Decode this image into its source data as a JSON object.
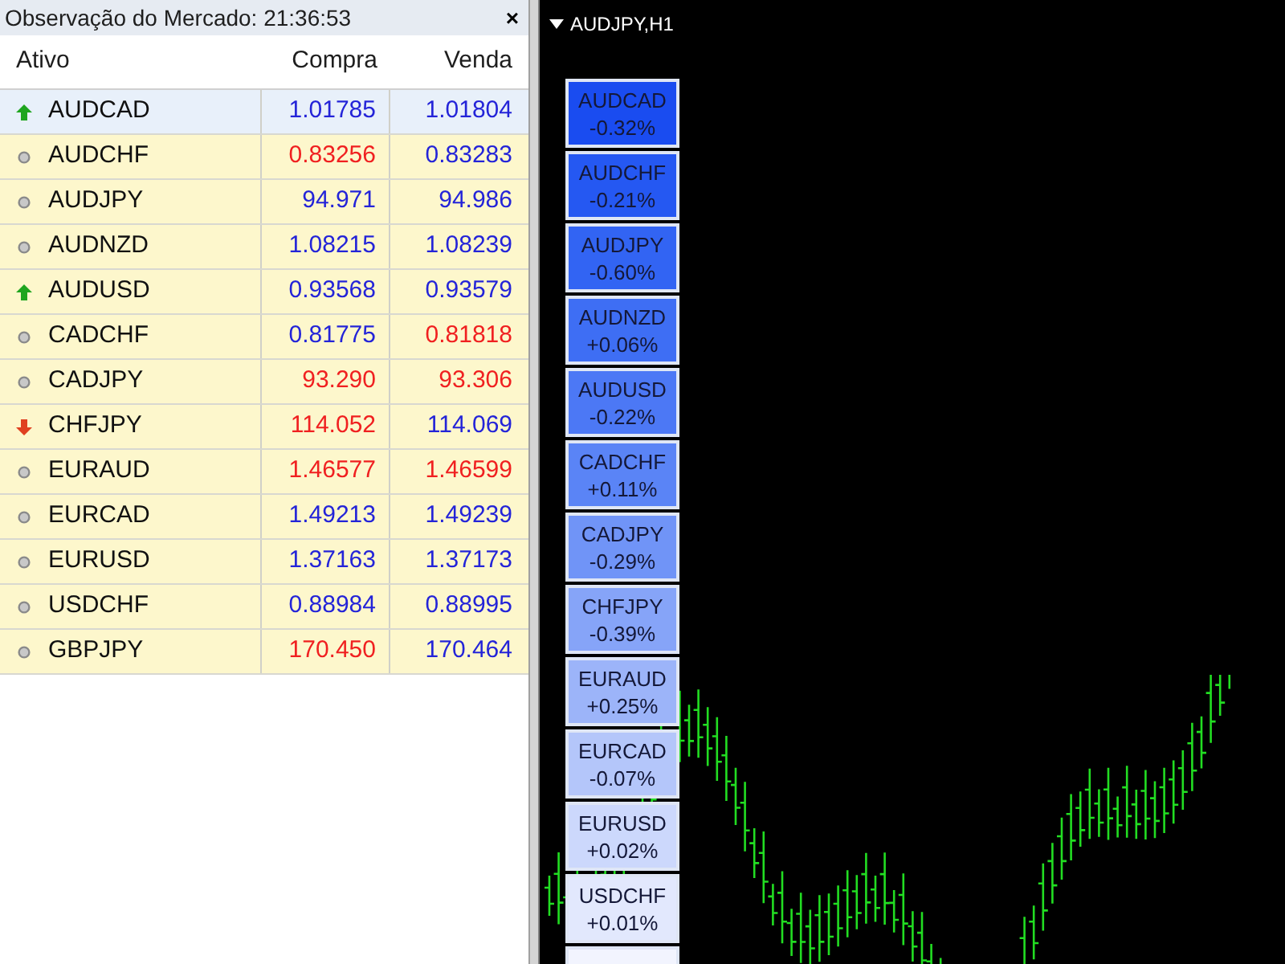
{
  "market_watch": {
    "title": "Observação do Mercado: 21:36:53",
    "close": "×",
    "columns": [
      "Ativo",
      "Compra",
      "Venda"
    ],
    "rows": [
      {
        "symbol": "AUDCAD",
        "kind": "up",
        "selected": true,
        "bid": {
          "text": "1.01785",
          "color": "#2424d8"
        },
        "ask": {
          "text": "1.01804",
          "color": "#2424d8"
        }
      },
      {
        "symbol": "AUDCHF",
        "kind": "none",
        "selected": false,
        "bid": {
          "text": "0.83256",
          "color": "#f02020"
        },
        "ask": {
          "text": "0.83283",
          "color": "#2424d8"
        }
      },
      {
        "symbol": "AUDJPY",
        "kind": "none",
        "selected": false,
        "bid": {
          "text": "94.971",
          "color": "#2424d8"
        },
        "ask": {
          "text": "94.986",
          "color": "#2424d8"
        }
      },
      {
        "symbol": "AUDNZD",
        "kind": "none",
        "selected": false,
        "bid": {
          "text": "1.08215",
          "color": "#2424d8"
        },
        "ask": {
          "text": "1.08239",
          "color": "#2424d8"
        }
      },
      {
        "symbol": "AUDUSD",
        "kind": "up",
        "selected": false,
        "bid": {
          "text": "0.93568",
          "color": "#2424d8"
        },
        "ask": {
          "text": "0.93579",
          "color": "#2424d8"
        }
      },
      {
        "symbol": "CADCHF",
        "kind": "none",
        "selected": false,
        "bid": {
          "text": "0.81775",
          "color": "#2424d8"
        },
        "ask": {
          "text": "0.81818",
          "color": "#f02020"
        }
      },
      {
        "symbol": "CADJPY",
        "kind": "none",
        "selected": false,
        "bid": {
          "text": "93.290",
          "color": "#f02020"
        },
        "ask": {
          "text": "93.306",
          "color": "#f02020"
        }
      },
      {
        "symbol": "CHFJPY",
        "kind": "down",
        "selected": false,
        "bid": {
          "text": "114.052",
          "color": "#f02020"
        },
        "ask": {
          "text": "114.069",
          "color": "#2424d8"
        }
      },
      {
        "symbol": "EURAUD",
        "kind": "none",
        "selected": false,
        "bid": {
          "text": "1.46577",
          "color": "#f02020"
        },
        "ask": {
          "text": "1.46599",
          "color": "#f02020"
        }
      },
      {
        "symbol": "EURCAD",
        "kind": "none",
        "selected": false,
        "bid": {
          "text": "1.49213",
          "color": "#2424d8"
        },
        "ask": {
          "text": "1.49239",
          "color": "#2424d8"
        }
      },
      {
        "symbol": "EURUSD",
        "kind": "none",
        "selected": false,
        "bid": {
          "text": "1.37163",
          "color": "#2424d8"
        },
        "ask": {
          "text": "1.37173",
          "color": "#2424d8"
        }
      },
      {
        "symbol": "USDCHF",
        "kind": "none",
        "selected": false,
        "bid": {
          "text": "0.88984",
          "color": "#2424d8"
        },
        "ask": {
          "text": "0.88995",
          "color": "#2424d8"
        }
      },
      {
        "symbol": "GBPJPY",
        "kind": "none",
        "selected": false,
        "bid": {
          "text": "170.450",
          "color": "#f02020"
        },
        "ask": {
          "text": "170.464",
          "color": "#2424d8"
        }
      }
    ]
  },
  "chart": {
    "title": "AUDJPY,H1",
    "tiles": [
      {
        "symbol": "AUDCAD",
        "change": "-0.32%",
        "color": "#1a4cf0"
      },
      {
        "symbol": "AUDCHF",
        "change": "-0.21%",
        "color": "#2558f2"
      },
      {
        "symbol": "AUDJPY",
        "change": "-0.60%",
        "color": "#3264f3"
      },
      {
        "symbol": "AUDNZD",
        "change": "+0.06%",
        "color": "#3e6ef4"
      },
      {
        "symbol": "AUDUSD",
        "change": "-0.22%",
        "color": "#4c78f5"
      },
      {
        "symbol": "CADCHF",
        "change": "+0.11%",
        "color": "#5a84f6"
      },
      {
        "symbol": "CADJPY",
        "change": "-0.29%",
        "color": "#7094f7"
      },
      {
        "symbol": "CHFJPY",
        "change": "-0.39%",
        "color": "#86a4f8"
      },
      {
        "symbol": "EURAUD",
        "change": "+0.25%",
        "color": "#9cb4f9"
      },
      {
        "symbol": "EURCAD",
        "change": "-0.07%",
        "color": "#b4c6fa"
      },
      {
        "symbol": "EURUSD",
        "change": "+0.02%",
        "color": "#ccd8fc"
      },
      {
        "symbol": "USDCHF",
        "change": "+0.01%",
        "color": "#e2e8fd"
      },
      {
        "color": "#f2f4fe"
      }
    ]
  }
}
